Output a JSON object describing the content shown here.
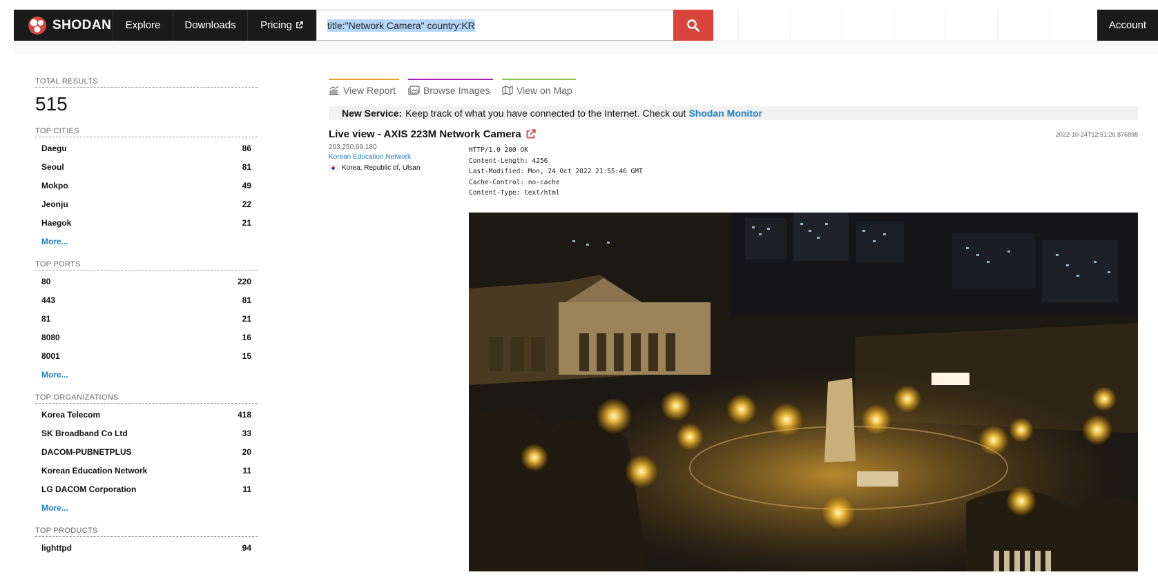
{
  "nav": {
    "brand": "SHODAN",
    "explore": "Explore",
    "downloads": "Downloads",
    "pricing": "Pricing",
    "account": "Account"
  },
  "search": {
    "query": "title:\"Network Camera\" country:KR"
  },
  "sidebar": {
    "total_label": "TOTAL RESULTS",
    "total_value": "515",
    "more_label": "More...",
    "facets": [
      {
        "title": "TOP CITIES",
        "items": [
          {
            "name": "Daegu",
            "count": "86"
          },
          {
            "name": "Seoul",
            "count": "81"
          },
          {
            "name": "Mokpo",
            "count": "49"
          },
          {
            "name": "Jeonju",
            "count": "22"
          },
          {
            "name": "Haegok",
            "count": "21"
          }
        ]
      },
      {
        "title": "TOP PORTS",
        "items": [
          {
            "name": "80",
            "count": "220"
          },
          {
            "name": "443",
            "count": "81"
          },
          {
            "name": "81",
            "count": "21"
          },
          {
            "name": "8080",
            "count": "16"
          },
          {
            "name": "8001",
            "count": "15"
          }
        ]
      },
      {
        "title": "TOP ORGANIZATIONS",
        "items": [
          {
            "name": "Korea Telecom",
            "count": "418"
          },
          {
            "name": "SK Broadband Co Ltd",
            "count": "33"
          },
          {
            "name": "DACOM-PUBNETPLUS",
            "count": "20"
          },
          {
            "name": "Korean Education Network",
            "count": "11"
          },
          {
            "name": "LG DACOM Corporation",
            "count": "11"
          }
        ]
      },
      {
        "title": "TOP PRODUCTS",
        "items": [
          {
            "name": "lighttpd",
            "count": "94"
          }
        ]
      }
    ]
  },
  "tabs": [
    {
      "label": "View Report",
      "icon": "chart-icon",
      "color": "#f0a12c"
    },
    {
      "label": "Browse Images",
      "icon": "images-icon",
      "color": "#a620b9"
    },
    {
      "label": "View on Map",
      "icon": "map-icon",
      "color": "#8bc34a"
    }
  ],
  "banner": {
    "bold": "New Service:",
    "text": "Keep track of what you have connected to the Internet. Check out",
    "link": "Shodan Monitor"
  },
  "result": {
    "title": "Live view - AXIS 223M Network Camera",
    "timestamp": "2022-10-24T12:51:26.876898",
    "ip": "203.250.69.180",
    "org": "Korean Education Network",
    "location": "Korea, Republic of, Ulsan",
    "headers": [
      "HTTP/1.0 200 OK",
      "Content-Length: 4256",
      "Last-Modified: Mon, 24 Oct 2022 21:55:46 GMT",
      "Cache-Control: no-cache",
      "Content-Type: text/html"
    ]
  },
  "colors": {
    "nav_bg": "#1a1a1a",
    "search_btn": "#d9443b",
    "link": "#1b7fc3"
  }
}
